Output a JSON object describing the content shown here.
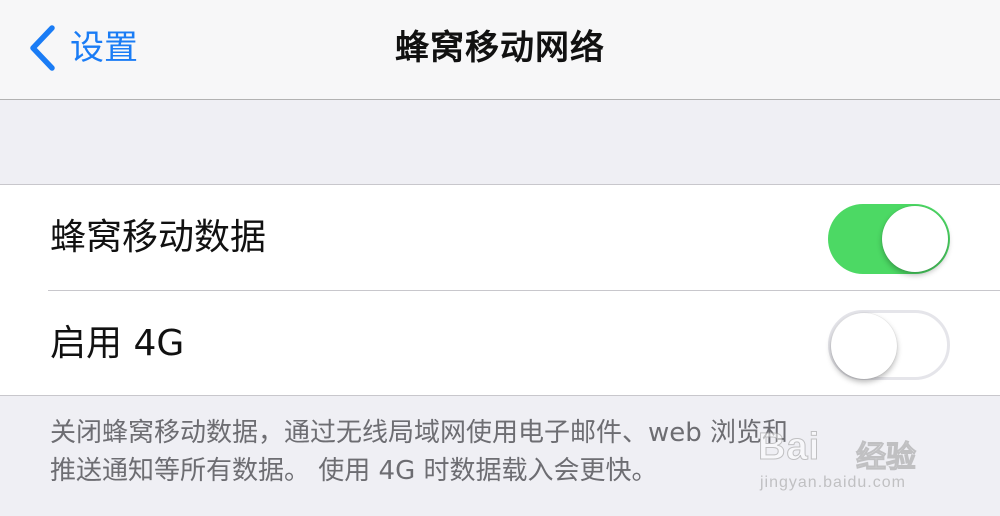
{
  "navbar": {
    "back_label": "设置",
    "title": "蜂窝移动网络"
  },
  "settings": {
    "rows": [
      {
        "label": "蜂窝移动数据",
        "toggle": "on"
      },
      {
        "label": "启用 4G",
        "toggle": "off"
      }
    ],
    "footer_line1": "关闭蜂窝移动数据，通过无线局域网使用电子邮件、web 浏览和",
    "footer_line2": "推送通知等所有数据。 使用 4G 时数据载入会更快。"
  },
  "watermark": {
    "brand": "Bai",
    "product": "经验",
    "url": "jingyan.baidu.com"
  },
  "colors": {
    "accent": "#1a7cf5",
    "toggle_on": "#4cd964",
    "background": "#efeff4"
  },
  "icons": {
    "back": "chevron-left-icon"
  }
}
